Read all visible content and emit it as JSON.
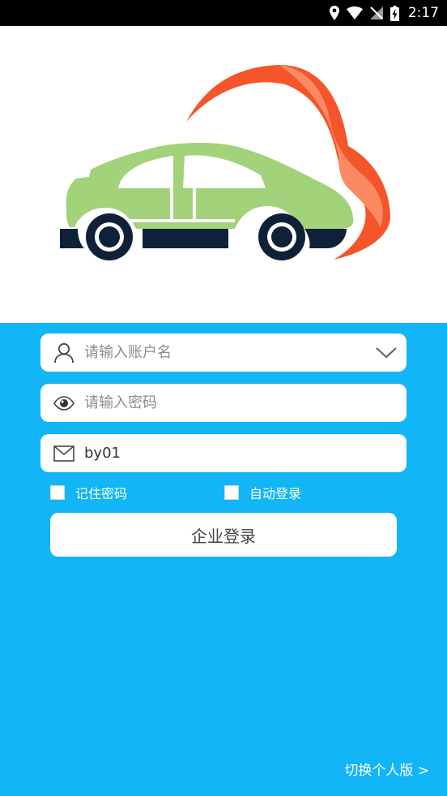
{
  "status_bar": {
    "time": "2:17",
    "icons": [
      "location-icon",
      "wifi-icon",
      "no-signal-icon",
      "battery-charging-icon"
    ]
  },
  "form": {
    "username": {
      "placeholder": "请输入账户名",
      "value": "",
      "icon": "user-icon"
    },
    "password": {
      "placeholder": "请输入密码",
      "value": "",
      "icon": "eye-icon"
    },
    "company_code": {
      "placeholder": "",
      "value": "by01",
      "icon": "mail-icon"
    },
    "remember_password_label": "记住密码",
    "auto_login_label": "自动登录",
    "login_button_label": "企业登录",
    "switch_link_label": "切换个人版 >"
  },
  "colors": {
    "panel_bg": "#12b5f5",
    "car_body": "#a2d279",
    "car_dark": "#0f2139",
    "flame_orange": "#f4552a",
    "flame_light": "#fb8a62"
  }
}
